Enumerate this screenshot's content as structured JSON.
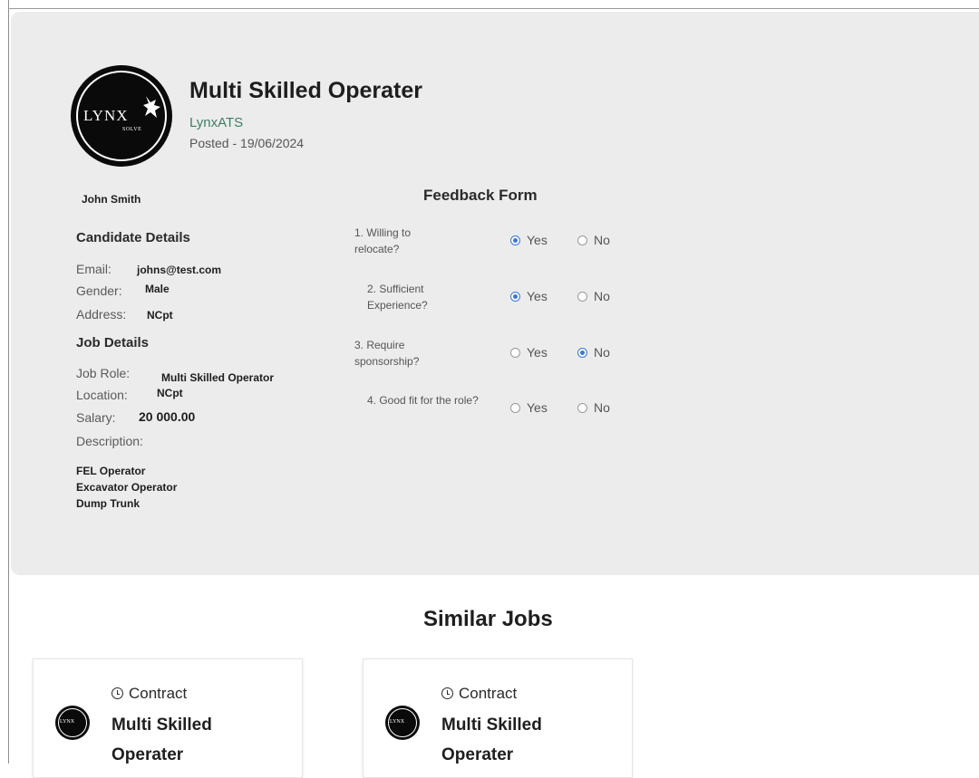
{
  "job": {
    "title": "Multi Skilled Operater",
    "company": "LynxATS",
    "posted": "Posted - 19/06/2024",
    "logo_text": "LYNX",
    "logo_subtext": "SOLVE"
  },
  "candidate": {
    "name": "John Smith",
    "section_title": "Candidate Details",
    "email_label": "Email:",
    "email": "johns@test.com",
    "gender_label": "Gender:",
    "gender": "Male",
    "address_label": "Address:",
    "address": "NCpt"
  },
  "job_details": {
    "section_title": "Job Details",
    "role_label": "Job Role:",
    "role": "Multi Skilled Operator",
    "location_label": "Location:",
    "location": "NCpt",
    "salary_label": "Salary:",
    "salary": "20 000.00",
    "description_label": "Description:",
    "description_lines": [
      "FEL Operator",
      "Excavator Operator",
      "Dump Trunk"
    ]
  },
  "feedback": {
    "title": "Feedback Form",
    "yes_label": "Yes",
    "no_label": "No",
    "questions": [
      {
        "text": "1. Willing to relocate?",
        "selected": "Yes"
      },
      {
        "text": "2. Sufficient Experience?",
        "selected": "Yes"
      },
      {
        "text": "3. Require sponsorship?",
        "selected": "No"
      },
      {
        "text": "4. Good fit for the role?",
        "selected": null
      }
    ]
  },
  "similar": {
    "title": "Similar Jobs",
    "cards": [
      {
        "type": "Contract",
        "title": "Multi Skilled Operater",
        "logo_text": "LYNX"
      },
      {
        "type": "Contract",
        "title": "Multi Skilled Operater",
        "logo_text": "LYNX"
      }
    ]
  },
  "colors": {
    "panel_bg": "#ececec",
    "company_green": "#3e7f62",
    "radio_blue": "#3a78d8"
  },
  "icons": [
    "lynx-logo-icon",
    "clock-icon"
  ]
}
